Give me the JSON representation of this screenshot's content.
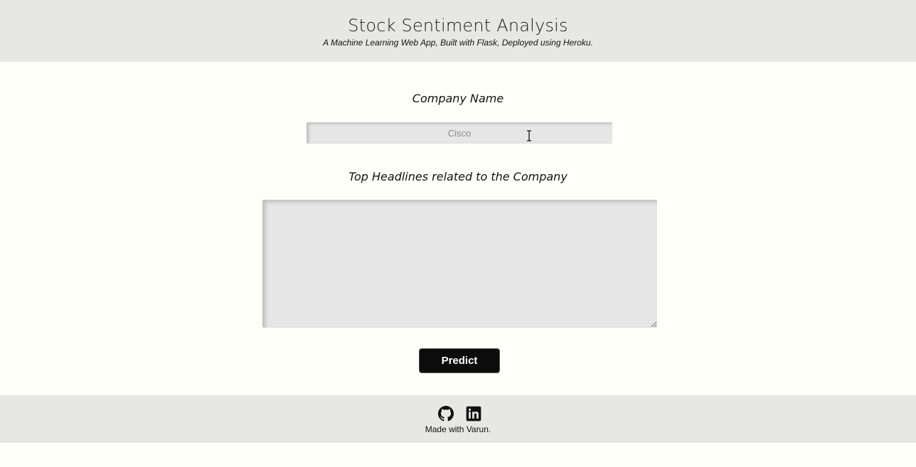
{
  "header": {
    "title": "Stock Sentiment Analysis",
    "subtitle": "A Machine Learning Web App, Built with Flask, Deployed using Heroku."
  },
  "form": {
    "company_label": "Company Name",
    "company_placeholder": "Cisco",
    "company_value": "",
    "headlines_label": "Top Headlines related to the Company",
    "headlines_value": "",
    "predict_label": "Predict"
  },
  "footer": {
    "icons": [
      "github-icon",
      "linkedin-icon"
    ],
    "credit": "Made with Varun."
  },
  "colors": {
    "page_background": "#fffffa",
    "band_background": "#e7e7e6",
    "field_background": "#e6e6e6",
    "button_background": "#0c0c0c",
    "button_text": "#ffffff"
  }
}
